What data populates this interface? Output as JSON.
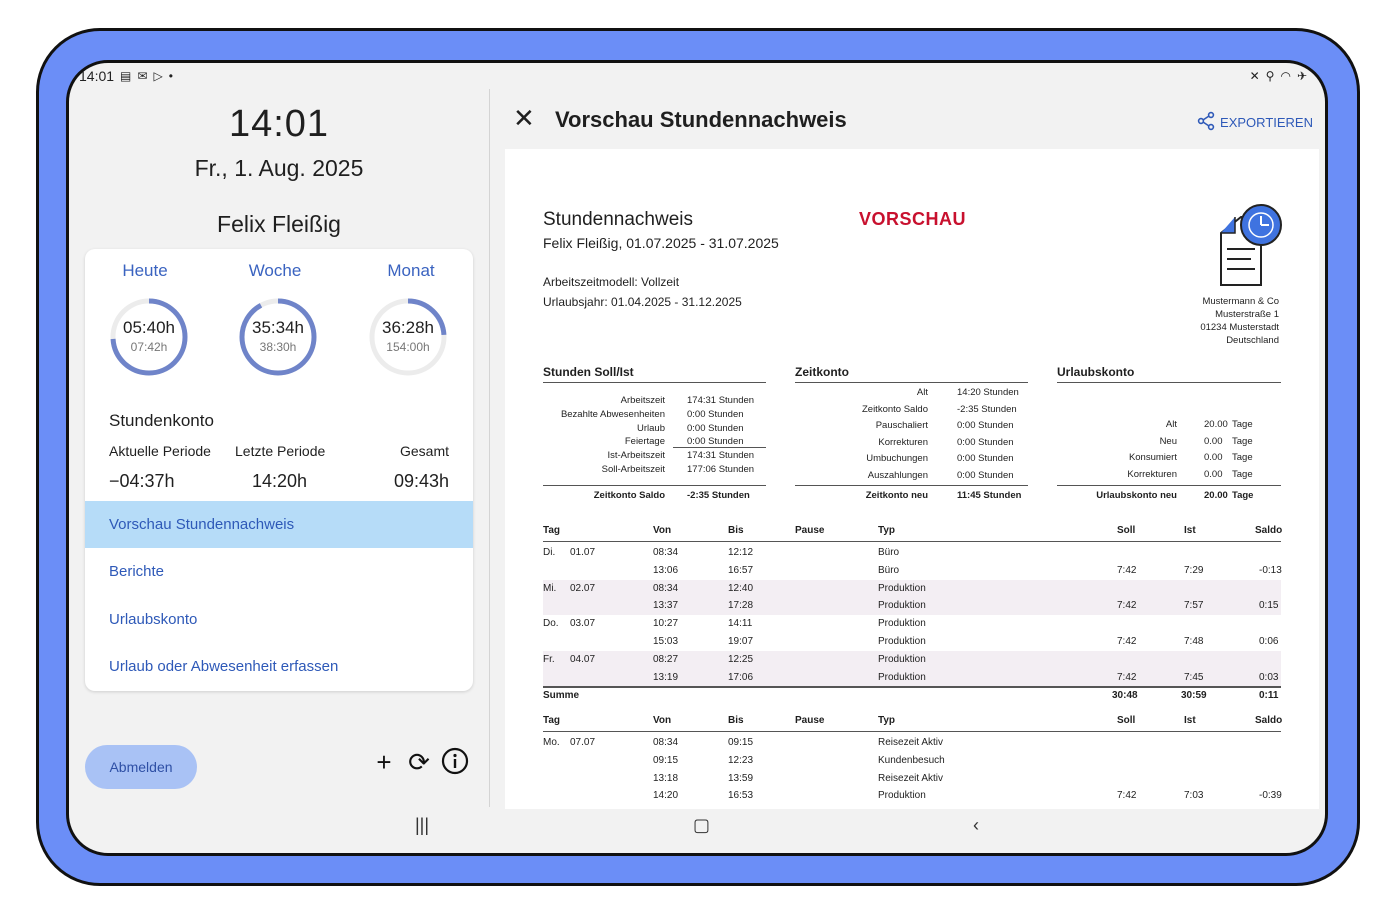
{
  "status_bar": {
    "time": "14:01",
    "icons_left": [
      "calendar-icon",
      "mail-icon",
      "play-store-icon",
      "dot"
    ],
    "icons_right": [
      "mute-icon",
      "location-icon",
      "wifi-icon",
      "airplane-icon"
    ]
  },
  "clock": {
    "time": "14:01",
    "date": "Fr., 1. Aug. 2025"
  },
  "user": {
    "name": "Felix Fleißig"
  },
  "periods": [
    {
      "label": "Heute",
      "value": "05:40h",
      "target": "07:42h",
      "progress": 0.74
    },
    {
      "label": "Woche",
      "value": "35:34h",
      "target": "38:30h",
      "progress": 0.92
    },
    {
      "label": "Monat",
      "value": "36:28h",
      "target": "154:00h",
      "progress": 0.24
    }
  ],
  "stundenkonto": {
    "title": "Stundenkonto",
    "headers": [
      "Aktuelle Periode",
      "Letzte Periode",
      "Gesamt"
    ],
    "values": [
      "−04:37h",
      "14:20h",
      "09:43h"
    ]
  },
  "menu": [
    {
      "label": "Vorschau Stundennachweis",
      "active": true
    },
    {
      "label": "Berichte",
      "active": false
    },
    {
      "label": "Urlaubskonto",
      "active": false
    },
    {
      "label": "Urlaub oder Abwesenheit erfassen",
      "active": false
    }
  ],
  "logout_label": "Abmelden",
  "toolbar_icons": [
    "plus-icon",
    "sync-icon",
    "info-icon"
  ],
  "preview_header": {
    "title": "Vorschau Stundennachweis",
    "export_label": "EXPORTIEREN"
  },
  "document": {
    "title": "Stundennachweis",
    "subtitle": "Felix Fleißig, 01.07.2025 - 31.07.2025",
    "watermark": "VORSCHAU",
    "model": "Arbeitszeitmodell: Vollzeit",
    "vacation_year": "Urlaubsjahr: 01.04.2025 - 31.12.2025",
    "company": [
      "Mustermann & Co",
      "Musterstraße 1",
      "01234 Musterstadt",
      "Deutschland"
    ],
    "soll_ist": {
      "title": "Stunden Soll/Ist",
      "rows": [
        {
          "label": "Arbeitszeit",
          "value": "174:31 Stunden"
        },
        {
          "label": "Bezahlte Abwesenheiten",
          "value": "0:00 Stunden"
        },
        {
          "label": "Urlaub",
          "value": "0:00 Stunden"
        },
        {
          "label": "Feiertage",
          "value": "0:00 Stunden"
        },
        {
          "label": "Ist-Arbeitszeit",
          "value": "174:31 Stunden"
        },
        {
          "label": "Soll-Arbeitszeit",
          "value": "177:06 Stunden"
        }
      ],
      "total": {
        "label": "Zeitkonto Saldo",
        "value": "-2:35 Stunden"
      }
    },
    "zeitkonto": {
      "title": "Zeitkonto",
      "rows": [
        {
          "label": "Alt",
          "value": "14:20 Stunden"
        },
        {
          "label": "Zeitkonto Saldo",
          "value": "-2:35 Stunden"
        },
        {
          "label": "Pauschaliert",
          "value": "0:00 Stunden"
        },
        {
          "label": "Korrekturen",
          "value": "0:00 Stunden"
        },
        {
          "label": "Umbuchungen",
          "value": "0:00 Stunden"
        },
        {
          "label": "Auszahlungen",
          "value": "0:00 Stunden"
        }
      ],
      "total": {
        "label": "Zeitkonto neu",
        "value": "11:45 Stunden"
      }
    },
    "urlaubskonto": {
      "title": "Urlaubskonto",
      "rows": [
        {
          "label": "Alt",
          "value": "20.00",
          "unit": "Tage"
        },
        {
          "label": "Neu",
          "value": "0.00",
          "unit": "Tage"
        },
        {
          "label": "Konsumiert",
          "value": "0.00",
          "unit": "Tage"
        },
        {
          "label": "Korrekturen",
          "value": "0.00",
          "unit": "Tage"
        }
      ],
      "total": {
        "label": "Urlaubskonto neu",
        "value": "20.00",
        "unit": "Tage"
      }
    },
    "table_headers": [
      "Tag",
      "Von",
      "Bis",
      "Pause",
      "Typ",
      "Soll",
      "Ist",
      "Saldo"
    ],
    "week1": [
      {
        "day": "Di.",
        "date": "01.07",
        "von": "08:34",
        "bis": "12:12",
        "typ": "Büro",
        "soll": "",
        "ist": "",
        "saldo": ""
      },
      {
        "day": "",
        "date": "",
        "von": "13:06",
        "bis": "16:57",
        "typ": "Büro",
        "soll": "7:42",
        "ist": "7:29",
        "saldo": "-0:13"
      },
      {
        "day": "Mi.",
        "date": "02.07",
        "von": "08:34",
        "bis": "12:40",
        "typ": "Produktion",
        "soll": "",
        "ist": "",
        "saldo": ""
      },
      {
        "day": "",
        "date": "",
        "von": "13:37",
        "bis": "17:28",
        "typ": "Produktion",
        "soll": "7:42",
        "ist": "7:57",
        "saldo": "0:15"
      },
      {
        "day": "Do.",
        "date": "03.07",
        "von": "10:27",
        "bis": "14:11",
        "typ": "Produktion",
        "soll": "",
        "ist": "",
        "saldo": ""
      },
      {
        "day": "",
        "date": "",
        "von": "15:03",
        "bis": "19:07",
        "typ": "Produktion",
        "soll": "7:42",
        "ist": "7:48",
        "saldo": "0:06"
      },
      {
        "day": "Fr.",
        "date": "04.07",
        "von": "08:27",
        "bis": "12:25",
        "typ": "Produktion",
        "soll": "",
        "ist": "",
        "saldo": ""
      },
      {
        "day": "",
        "date": "",
        "von": "13:19",
        "bis": "17:06",
        "typ": "Produktion",
        "soll": "7:42",
        "ist": "7:45",
        "saldo": "0:03"
      }
    ],
    "week1_sum": {
      "label": "Summe",
      "soll": "30:48",
      "ist": "30:59",
      "saldo": "0:11"
    },
    "week2": [
      {
        "day": "Mo.",
        "date": "07.07",
        "von": "08:34",
        "bis": "09:15",
        "typ": "Reisezeit Aktiv",
        "soll": "",
        "ist": "",
        "saldo": ""
      },
      {
        "day": "",
        "date": "",
        "von": "09:15",
        "bis": "12:23",
        "typ": "Kundenbesuch",
        "soll": "",
        "ist": "",
        "saldo": ""
      },
      {
        "day": "",
        "date": "",
        "von": "13:18",
        "bis": "13:59",
        "typ": "Reisezeit Aktiv",
        "soll": "",
        "ist": "",
        "saldo": ""
      },
      {
        "day": "",
        "date": "",
        "von": "14:20",
        "bis": "16:53",
        "typ": "Produktion",
        "soll": "7:42",
        "ist": "7:03",
        "saldo": "-0:39"
      }
    ]
  }
}
